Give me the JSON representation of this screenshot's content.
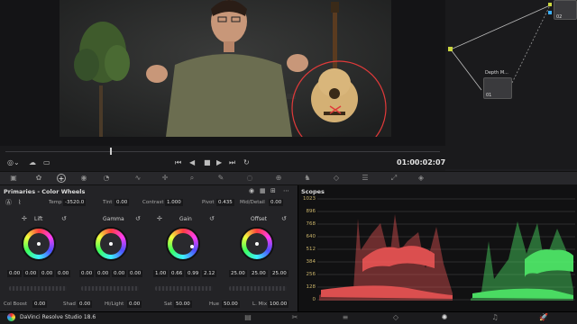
{
  "viewer": {
    "timecode": "01:00:02:07"
  },
  "nodes": {
    "node1_label": "Depth M...",
    "node1_num": "01",
    "node2_num": "02"
  },
  "primaries": {
    "title": "Primaries - Color Wheels",
    "temp_label": "Temp",
    "temp_value": "-3520.0",
    "tint_label": "Tint",
    "tint_value": "0.00",
    "contrast_label": "Contrast",
    "contrast_value": "1.000",
    "pivot_label": "Pivot",
    "pivot_value": "0.435",
    "middetail_label": "Mid/Detail",
    "middetail_value": "0.00",
    "wheels": [
      {
        "name": "Lift",
        "values": [
          "0.00",
          "0.00",
          "0.00",
          "0.00"
        ]
      },
      {
        "name": "Gamma",
        "values": [
          "0.00",
          "0.00",
          "0.00",
          "0.00"
        ]
      },
      {
        "name": "Gain",
        "values": [
          "1.00",
          "0.66",
          "0.99",
          "2.12"
        ]
      },
      {
        "name": "Offset",
        "values": [
          "25.00",
          "25.00",
          "25.00"
        ]
      }
    ],
    "bottom": {
      "colboost_label": "Col Boost",
      "colboost_value": "0.00",
      "shad_label": "Shad",
      "shad_value": "0.00",
      "hilight_label": "Hi/Light",
      "hilight_value": "0.00",
      "sat_label": "Sat",
      "sat_value": "50.00",
      "hue_label": "Hue",
      "hue_value": "50.00",
      "lmix_label": "L. Mix",
      "lmix_value": "100.00"
    }
  },
  "scopes": {
    "title": "Scopes",
    "ticks": [
      "1023",
      "896",
      "768",
      "640",
      "512",
      "384",
      "256",
      "128",
      "0"
    ]
  },
  "footer": {
    "app_name": "DaVinci Resolve Studio 18.6"
  },
  "colors": {
    "accent": "#ff3b3b",
    "scope_red": "#ff6464",
    "scope_green": "#5cff7a"
  }
}
